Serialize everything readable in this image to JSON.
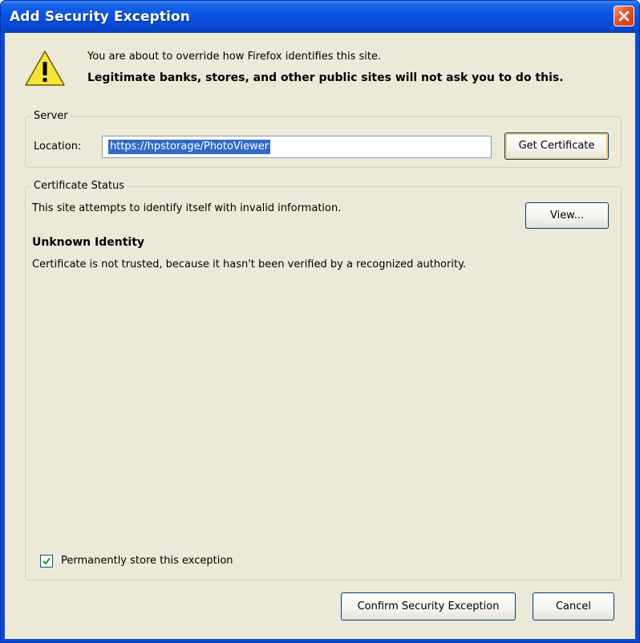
{
  "window": {
    "title": "Add Security Exception"
  },
  "intro": {
    "line1": "You are about to override how Firefox identifies this site.",
    "line2": "Legitimate banks, stores, and other public sites will not ask you to do this."
  },
  "server": {
    "legend": "Server",
    "location_label": "Location:",
    "location_value": "https://hpstorage/PhotoViewer",
    "get_certificate_label": "Get Certificate"
  },
  "certificate_status": {
    "legend": "Certificate Status",
    "status_text": "This site attempts to identify itself with invalid information.",
    "view_label": "View...",
    "identity_title": "Unknown Identity",
    "identity_description": "Certificate is not trusted, because it hasn't been verified by a recognized authority."
  },
  "permanent": {
    "checked": true,
    "label": "Permanently store this exception"
  },
  "buttons": {
    "confirm": "Confirm Security Exception",
    "cancel": "Cancel"
  },
  "icons": {
    "close": "close-icon",
    "warning": "warning-icon",
    "checkmark": "checkmark-icon"
  },
  "colors": {
    "titlebar": "#0a53e0",
    "dialog_bg": "#ece9d8",
    "selection": "#316ac5",
    "close_button": "#e2542d"
  }
}
